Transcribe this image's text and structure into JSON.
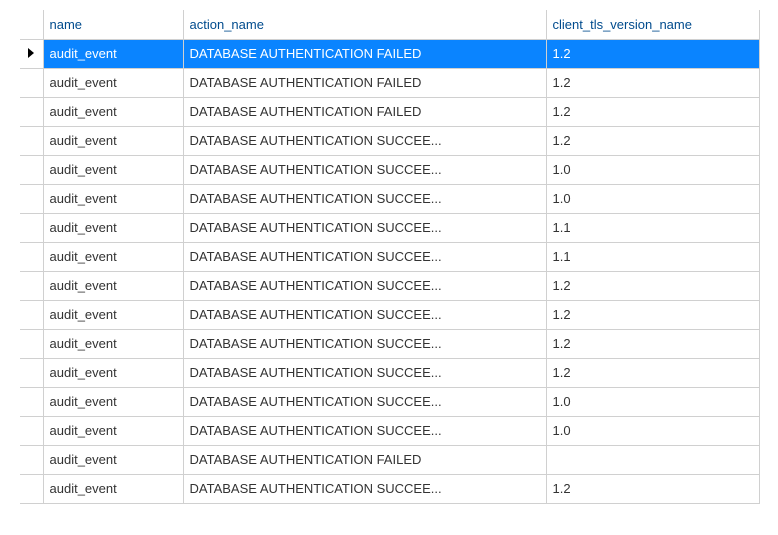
{
  "columns": {
    "name": "name",
    "action_name": "action_name",
    "client_tls_version_name": "client_tls_version_name"
  },
  "rows": [
    {
      "selected": true,
      "name": "audit_event",
      "action_name": "DATABASE AUTHENTICATION FAILED",
      "tls": "1.2"
    },
    {
      "selected": false,
      "name": "audit_event",
      "action_name": "DATABASE AUTHENTICATION FAILED",
      "tls": "1.2"
    },
    {
      "selected": false,
      "name": "audit_event",
      "action_name": "DATABASE AUTHENTICATION FAILED",
      "tls": "1.2"
    },
    {
      "selected": false,
      "name": "audit_event",
      "action_name": "DATABASE AUTHENTICATION SUCCEE...",
      "tls": "1.2"
    },
    {
      "selected": false,
      "name": "audit_event",
      "action_name": "DATABASE AUTHENTICATION SUCCEE...",
      "tls": "1.0"
    },
    {
      "selected": false,
      "name": "audit_event",
      "action_name": "DATABASE AUTHENTICATION SUCCEE...",
      "tls": "1.0"
    },
    {
      "selected": false,
      "name": "audit_event",
      "action_name": "DATABASE AUTHENTICATION SUCCEE...",
      "tls": "1.1"
    },
    {
      "selected": false,
      "name": "audit_event",
      "action_name": "DATABASE AUTHENTICATION SUCCEE...",
      "tls": "1.1"
    },
    {
      "selected": false,
      "name": "audit_event",
      "action_name": "DATABASE AUTHENTICATION SUCCEE...",
      "tls": "1.2"
    },
    {
      "selected": false,
      "name": "audit_event",
      "action_name": "DATABASE AUTHENTICATION SUCCEE...",
      "tls": "1.2"
    },
    {
      "selected": false,
      "name": "audit_event",
      "action_name": "DATABASE AUTHENTICATION SUCCEE...",
      "tls": "1.2"
    },
    {
      "selected": false,
      "name": "audit_event",
      "action_name": "DATABASE AUTHENTICATION SUCCEE...",
      "tls": "1.2"
    },
    {
      "selected": false,
      "name": "audit_event",
      "action_name": "DATABASE AUTHENTICATION SUCCEE...",
      "tls": "1.0"
    },
    {
      "selected": false,
      "name": "audit_event",
      "action_name": "DATABASE AUTHENTICATION SUCCEE...",
      "tls": "1.0"
    },
    {
      "selected": false,
      "name": "audit_event",
      "action_name": "DATABASE AUTHENTICATION FAILED",
      "tls": ""
    },
    {
      "selected": false,
      "name": "audit_event",
      "action_name": "DATABASE AUTHENTICATION SUCCEE...",
      "tls": "1.2"
    }
  ]
}
